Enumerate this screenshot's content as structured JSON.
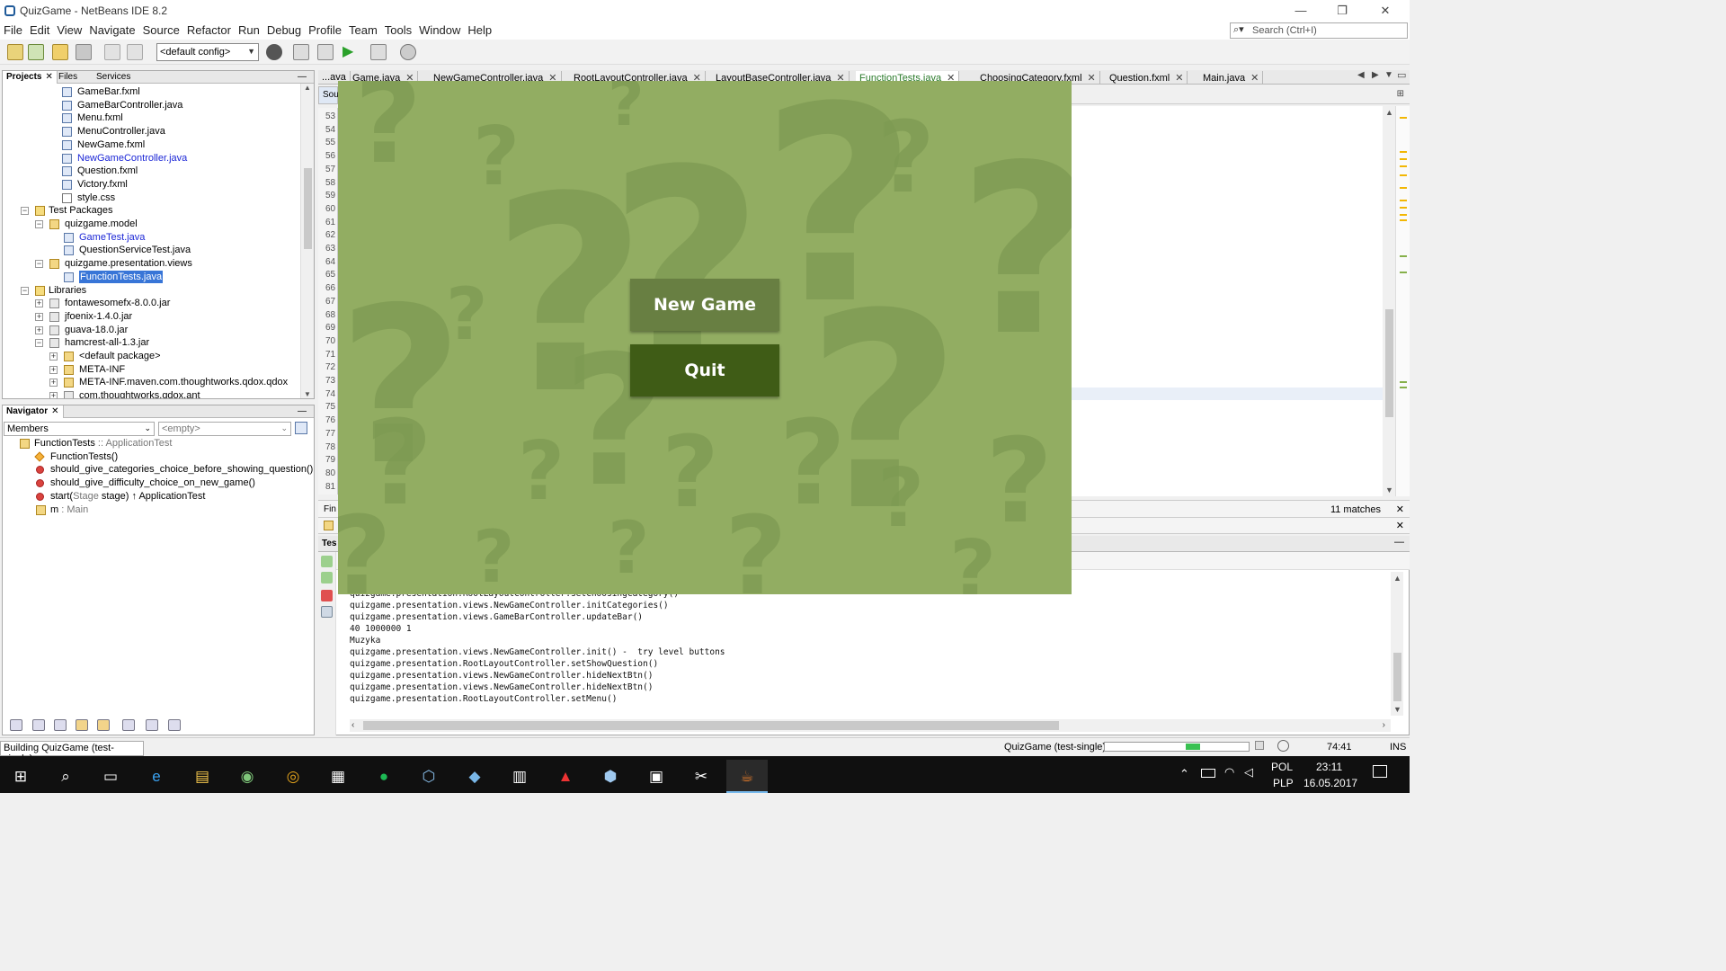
{
  "window": {
    "title": "QuizGame - NetBeans IDE 8.2",
    "minimize": "—",
    "restore": "❐",
    "close": "✕"
  },
  "menu": [
    "File",
    "Edit",
    "View",
    "Navigate",
    "Source",
    "Refactor",
    "Run",
    "Debug",
    "Profile",
    "Team",
    "Tools",
    "Window",
    "Help"
  ],
  "search": {
    "placeholder": "Search (Ctrl+I)",
    "icon": "search-icon"
  },
  "toolbar": {
    "config": "<default config>"
  },
  "projects_panel": {
    "tabs": [
      "Projects",
      "Files",
      "Services"
    ],
    "close_glyph": "✕",
    "minimize_glyph": "—",
    "tree": [
      {
        "label": "GameBar.fxml",
        "depth": 4,
        "icon": "fxml"
      },
      {
        "label": "GameBarController.java",
        "depth": 4,
        "icon": "java"
      },
      {
        "label": "Menu.fxml",
        "depth": 4,
        "icon": "fxml"
      },
      {
        "label": "MenuController.java",
        "depth": 4,
        "icon": "java"
      },
      {
        "label": "NewGame.fxml",
        "depth": 4,
        "icon": "fxml"
      },
      {
        "label": "NewGameController.java",
        "depth": 4,
        "icon": "java",
        "modified": true
      },
      {
        "label": "Question.fxml",
        "depth": 4,
        "icon": "fxml"
      },
      {
        "label": "Victory.fxml",
        "depth": 4,
        "icon": "fxml"
      },
      {
        "label": "style.css",
        "depth": 4,
        "icon": "css"
      },
      {
        "label": "Test Packages",
        "depth": 1,
        "icon": "folder",
        "expander": "−"
      },
      {
        "label": "quizgame.model",
        "depth": 2,
        "icon": "package",
        "expander": "−"
      },
      {
        "label": "GameTest.java",
        "depth": 3,
        "icon": "java",
        "modified": true
      },
      {
        "label": "QuestionServiceTest.java",
        "depth": 3,
        "icon": "java"
      },
      {
        "label": "quizgame.presentation.views",
        "depth": 2,
        "icon": "package",
        "expander": "−"
      },
      {
        "label": "FunctionTests.java",
        "depth": 3,
        "icon": "java",
        "selected": true
      },
      {
        "label": "Libraries",
        "depth": 1,
        "icon": "folder",
        "expander": "−"
      },
      {
        "label": "fontawesomefx-8.0.0.jar",
        "depth": 2,
        "icon": "jar",
        "expander": "+"
      },
      {
        "label": "jfoenix-1.4.0.jar",
        "depth": 2,
        "icon": "jar",
        "expander": "+"
      },
      {
        "label": "guava-18.0.jar",
        "depth": 2,
        "icon": "jar",
        "expander": "+"
      },
      {
        "label": "hamcrest-all-1.3.jar",
        "depth": 2,
        "icon": "jar",
        "expander": "−"
      },
      {
        "label": "<default package>",
        "depth": 3,
        "icon": "package",
        "expander": "+"
      },
      {
        "label": "META-INF",
        "depth": 3,
        "icon": "package",
        "expander": "+"
      },
      {
        "label": "META-INF.maven.com.thoughtworks.qdox.qdox",
        "depth": 3,
        "icon": "package",
        "expander": "+"
      },
      {
        "label": "com.thoughtworks.qdox.ant",
        "depth": 3,
        "icon": "jar",
        "expander": "+"
      }
    ]
  },
  "navigator": {
    "tab": "Navigator",
    "filter": "Members",
    "filter2": "<empty>",
    "items": [
      {
        "text": "FunctionTests",
        "suffix": " :: ApplicationTest",
        "kind": "class"
      },
      {
        "text": "FunctionTests()",
        "suffix": "",
        "kind": "constructor"
      },
      {
        "text": "should_give_categories_choice_before_showing_question()",
        "suffix": "",
        "kind": "method"
      },
      {
        "text": "should_give_difficulty_choice_on_new_game()",
        "suffix": "",
        "kind": "method"
      },
      {
        "text": "start(",
        "gray1": "Stage",
        "mid": " stage) ↑ ApplicationTest",
        "kind": "method"
      },
      {
        "text": "m",
        "suffix": " : Main",
        "kind": "field"
      }
    ]
  },
  "editor": {
    "tabs": [
      {
        "label": "...ava",
        "close": false
      },
      {
        "label": "Game.java",
        "close": true
      },
      {
        "label": "NewGameController.java",
        "close": true,
        "modified": true
      },
      {
        "label": "RootLayoutController.java",
        "close": true
      },
      {
        "label": "LayoutBaseController.java",
        "close": true
      },
      {
        "label": "FunctionTests.java",
        "close": true,
        "active": true
      },
      {
        "label": "ChoosingCategory.fxml",
        "close": true
      },
      {
        "label": "Question.fxml",
        "close": true
      },
      {
        "label": "Main.java",
        "close": true,
        "modified": true
      }
    ],
    "source_tab": "Sou",
    "line_numbers": [
      "53",
      "54",
      "55",
      "56",
      "57",
      "58",
      "59",
      "60",
      "61",
      "62",
      "63",
      "64",
      "65",
      "66",
      "67",
      "68",
      "69",
      "70",
      "71",
      "72",
      "73",
      "74",
      "75",
      "76",
      "77",
      "78",
      "79",
      "80",
      "81"
    ],
    "find_label": "Fin",
    "matches": "11 matches"
  },
  "test_results": {
    "tab": "Tes",
    "console": [
      "quizgame.presentation.RootLayoutController.setChoosingCategory()",
      "quizgame.presentation.views.NewGameController.initCategories()",
      "quizgame.presentation.views.GameBarController.updateBar()",
      "40 1000000 1",
      "Muzyka",
      "quizgame.presentation.views.NewGameController.init() -  try level buttons",
      "quizgame.presentation.RootLayoutController.setShowQuestion()",
      "quizgame.presentation.views.NewGameController.hideNextBtn()",
      "quizgame.presentation.views.NewGameController.hideNextBtn()",
      "quizgame.presentation.RootLayoutController.setMenu()"
    ]
  },
  "game": {
    "new_game": "New Game",
    "quit": "Quit",
    "background": "#92ad62",
    "btn_new_color": "#687f42",
    "btn_quit_color": "#3f5c16"
  },
  "status": {
    "building": "Building QuizGame (test-single)...",
    "task": "QuizGame (test-single)",
    "progress": 0.1,
    "position": "74:41",
    "mode": "INS"
  },
  "taskbar": {
    "apps": [
      "windows-logo-icon",
      "search-icon",
      "task-view-icon",
      "edge-icon",
      "file-explorer-icon",
      "android-studio-icon",
      "chrome-icon",
      "store-icon",
      "spotify-icon",
      "virtualbox-icon",
      "word-icon",
      "notepad-icon",
      "acrobat-icon",
      "3d-box-icon",
      "finder-icon",
      "snipping-icon",
      "java-icon"
    ],
    "lang1": "POL",
    "lang2": "PLP",
    "time": "23:11",
    "date": "16.05.2017"
  }
}
